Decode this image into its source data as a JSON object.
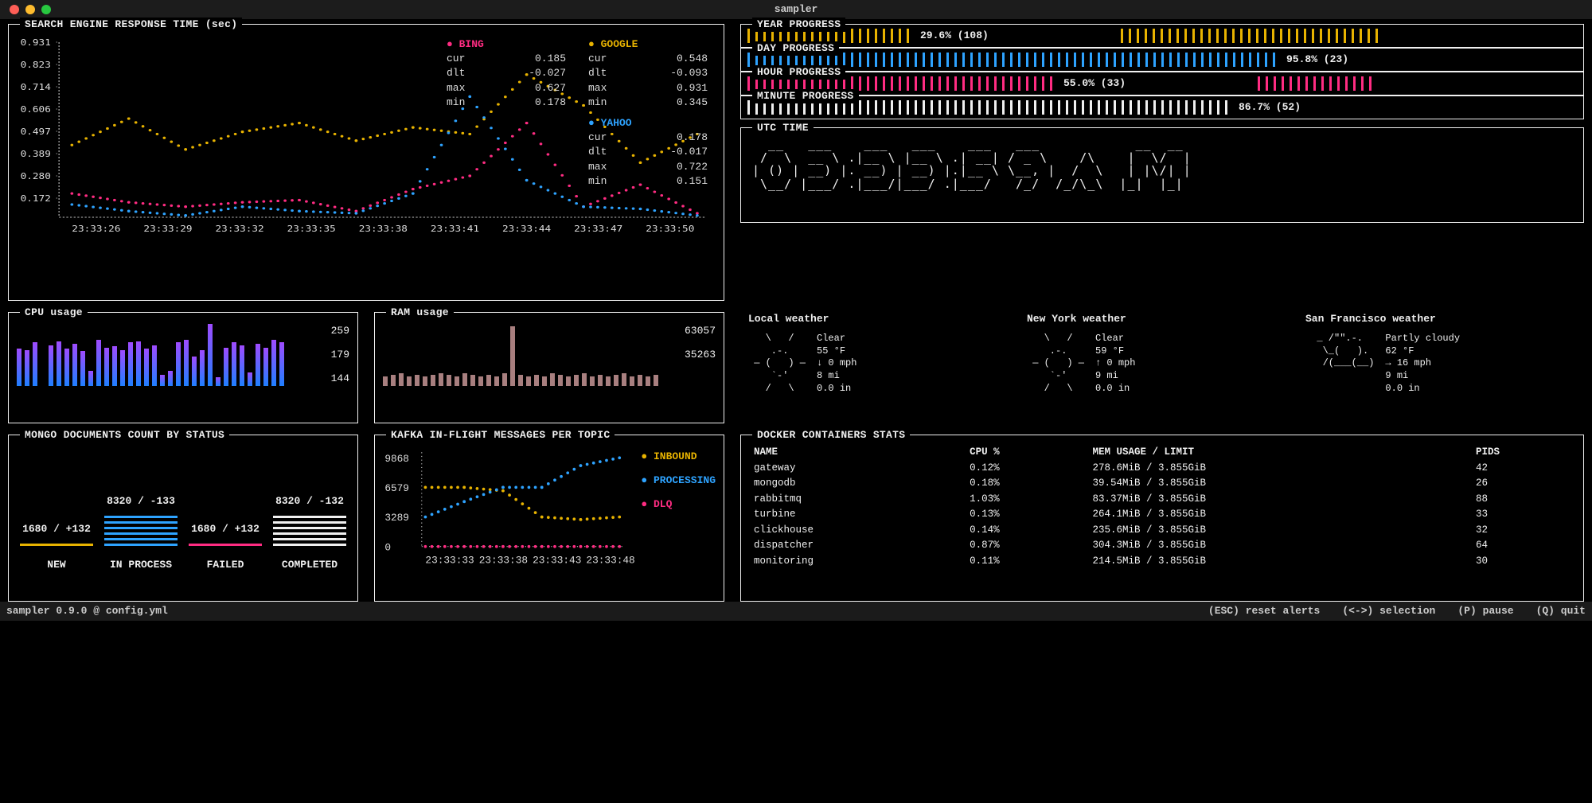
{
  "window_title": "sampler",
  "search": {
    "title": "SEARCH ENGINE RESPONSE TIME (sec)",
    "y_ticks": [
      "0.931",
      "0.823",
      "0.714",
      "0.606",
      "0.497",
      "0.389",
      "0.280",
      "0.172"
    ],
    "x_ticks": [
      "23:33:26",
      "23:33:29",
      "23:33:32",
      "23:33:35",
      "23:33:38",
      "23:33:41",
      "23:33:44",
      "23:33:47",
      "23:33:50"
    ],
    "series": [
      {
        "name": "BING",
        "color": "#ff2c82",
        "stats": {
          "cur": "0.185",
          "dlt": "-0.027",
          "max": "0.627",
          "min": "0.178"
        }
      },
      {
        "name": "GOOGLE",
        "color": "#e8b300",
        "stats": {
          "cur": "0.548",
          "dlt": "-0.093",
          "max": "0.931",
          "min": "0.345"
        }
      },
      {
        "name": "YAHOO",
        "color": "#2ea3ff",
        "stats": {
          "cur": "0.178",
          "dlt": "-0.017",
          "max": "0.722",
          "min": "0.151"
        }
      }
    ]
  },
  "progress": [
    {
      "title": "YEAR PROGRESS",
      "color": "#e8b300",
      "pct": 29.6,
      "count": 108,
      "label": "29.6% (108)"
    },
    {
      "title": "DAY PROGRESS",
      "color": "#2ea3ff",
      "pct": 95.8,
      "count": 23,
      "label": "95.8% (23)"
    },
    {
      "title": "HOUR PROGRESS",
      "color": "#ff2c82",
      "pct": 55.0,
      "count": 33,
      "label": "55.0% (33)"
    },
    {
      "title": "MINUTE PROGRESS",
      "color": "#f0f0f0",
      "pct": 86.7,
      "count": 52,
      "label": "86.7% (52)"
    }
  ],
  "utc": {
    "title": "UTC TIME",
    "ascii": "  __   ___    ___   ___    ___   ___            __  __\n /  \\  __ \\ .|__ \\ |__ \\ .| __| / _ \\    /\\    |  \\/  |\n| () | __) |. __) | __) |.|__ \\ \\__, |  /  \\   | |\\/| |\n \\__/ |___/ .|___/|___/ .|___/   /_/  /_/\\_\\  |_|  |_|",
    "display": "03:33:52 AM"
  },
  "cpu": {
    "title": "CPU usage",
    "vals": [
      "259",
      "179",
      "144"
    ],
    "bars": [
      60,
      58,
      70,
      0,
      65,
      72,
      60,
      68,
      56,
      24,
      74,
      62,
      64,
      58,
      70,
      72,
      60,
      66,
      18,
      24,
      70,
      74,
      48,
      58,
      100,
      14,
      62,
      70,
      66,
      22,
      68,
      62,
      74,
      70
    ]
  },
  "ram": {
    "title": "RAM usage",
    "vals": [
      "63057",
      "35263"
    ],
    "bars": [
      8,
      9,
      10,
      8,
      9,
      8,
      9,
      10,
      9,
      8,
      10,
      9,
      8,
      9,
      8,
      10,
      48,
      9,
      8,
      9,
      8,
      10,
      9,
      8,
      9,
      10,
      8,
      9,
      8,
      9,
      10,
      8,
      9,
      8,
      9
    ]
  },
  "mongo": {
    "title": "MONGO DOCUMENTS COUNT BY STATUS",
    "cols": [
      {
        "label": "NEW",
        "value": "1680 / +132",
        "bars": 0,
        "color": "#e8b300"
      },
      {
        "label": "IN PROCESS",
        "value": "8320 / -133",
        "bars": 5,
        "color": "#2ea3ff"
      },
      {
        "label": "FAILED",
        "value": "1680 / +132",
        "bars": 0,
        "color": "#ff2c82"
      },
      {
        "label": "COMPLETED",
        "value": "8320 / -132",
        "bars": 5,
        "color": "#f0f0f0"
      }
    ]
  },
  "kafka": {
    "title": "KAFKA IN-FLIGHT MESSAGES PER TOPIC",
    "y_ticks": [
      "9868",
      "6579",
      "3289",
      "0"
    ],
    "x_ticks": [
      "23:33:33",
      "23:33:38",
      "23:33:43",
      "23:33:48"
    ],
    "series": [
      {
        "name": "INBOUND",
        "color": "#e8b300"
      },
      {
        "name": "PROCESSING",
        "color": "#2ea3ff"
      },
      {
        "name": "DLQ",
        "color": "#ff2c82"
      }
    ]
  },
  "weather": [
    {
      "title": "Local weather",
      "icon": "   \\   /\n    .-.\n ― (   ) ―\n    `-'\n   /   \\",
      "lines": [
        "Clear",
        "55 °F",
        "↓ 0 mph",
        "8 mi",
        "0.0 in"
      ]
    },
    {
      "title": "New York weather",
      "icon": "   \\   /\n    .-.\n ― (   ) ―\n    `-'\n   /   \\",
      "lines": [
        "Clear",
        "59 °F",
        "↑ 0 mph",
        "9 mi",
        "0.0 in"
      ]
    },
    {
      "title": "San Francisco weather",
      "icon": "  _ /\"\".-.\n   \\_(   ).\n   /(___(__)\n",
      "lines": [
        "Partly cloudy",
        "62 °F",
        "→ 16 mph",
        "9 mi",
        "0.0 in"
      ]
    }
  ],
  "docker": {
    "title": "DOCKER CONTAINERS STATS",
    "headers": [
      "NAME",
      "CPU %",
      "MEM USAGE / LIMIT",
      "PIDS"
    ],
    "rows": [
      [
        "gateway",
        "0.12%",
        "278.6MiB / 3.855GiB",
        "42"
      ],
      [
        "mongodb",
        "0.18%",
        "39.54MiB / 3.855GiB",
        "26"
      ],
      [
        "rabbitmq",
        "1.03%",
        "83.37MiB / 3.855GiB",
        "88"
      ],
      [
        "turbine",
        "0.13%",
        "264.1MiB / 3.855GiB",
        "33"
      ],
      [
        "clickhouse",
        "0.14%",
        "235.6MiB / 3.855GiB",
        "32"
      ],
      [
        "dispatcher",
        "0.87%",
        "304.3MiB / 3.855GiB",
        "64"
      ],
      [
        "monitoring",
        "0.11%",
        "214.5MiB / 3.855GiB",
        "30"
      ]
    ]
  },
  "footer": {
    "left": "sampler 0.9.0 @ config.yml",
    "items": [
      "(ESC) reset alerts",
      "(<->) selection",
      "(P) pause",
      "(Q) quit"
    ]
  },
  "chart_data": {
    "search_engine_response_time": {
      "type": "line",
      "xlabel": "",
      "ylabel": "sec",
      "ylim": [
        0.172,
        0.931
      ],
      "x": [
        "23:33:26",
        "23:33:29",
        "23:33:32",
        "23:33:35",
        "23:33:38",
        "23:33:41",
        "23:33:44",
        "23:33:47",
        "23:33:50"
      ],
      "series": [
        {
          "name": "BING",
          "values": [
            0.28,
            0.24,
            0.22,
            0.24,
            0.25,
            0.2,
            0.3,
            0.36,
            0.6,
            0.22,
            0.32,
            0.19
          ]
        },
        {
          "name": "GOOGLE",
          "values": [
            0.5,
            0.62,
            0.48,
            0.56,
            0.6,
            0.52,
            0.58,
            0.55,
            0.82,
            0.68,
            0.42,
            0.55
          ]
        },
        {
          "name": "YAHOO",
          "values": [
            0.23,
            0.2,
            0.18,
            0.22,
            0.2,
            0.19,
            0.28,
            0.72,
            0.34,
            0.22,
            0.21,
            0.18
          ]
        }
      ]
    },
    "cpu_usage": {
      "type": "bar",
      "values": [
        60,
        58,
        70,
        0,
        65,
        72,
        60,
        68,
        56,
        24,
        74,
        62,
        64,
        58,
        70,
        72,
        60,
        66,
        18,
        24,
        70,
        74,
        48,
        58,
        100,
        14,
        62,
        70,
        66,
        22,
        68,
        62,
        74,
        70
      ],
      "labels": [
        "259",
        "179",
        "144"
      ]
    },
    "ram_usage": {
      "type": "bar",
      "values": [
        8,
        9,
        10,
        8,
        9,
        8,
        9,
        10,
        9,
        8,
        10,
        9,
        8,
        9,
        8,
        10,
        48,
        9,
        8,
        9,
        8,
        10,
        9,
        8,
        9,
        10,
        8,
        9,
        8,
        9,
        10,
        8,
        9,
        8,
        9
      ],
      "labels": [
        "63057",
        "35263"
      ]
    },
    "kafka": {
      "type": "line",
      "ylim": [
        0,
        9868
      ],
      "x": [
        "23:33:33",
        "23:33:38",
        "23:33:43",
        "23:33:48"
      ],
      "series": [
        {
          "name": "INBOUND",
          "values": [
            6579,
            6579,
            6200,
            3289,
            3000,
            3289
          ]
        },
        {
          "name": "PROCESSING",
          "values": [
            3289,
            5000,
            6579,
            6579,
            9000,
            9868
          ]
        },
        {
          "name": "DLQ",
          "values": [
            0,
            0,
            0,
            0,
            0,
            0
          ]
        }
      ]
    },
    "mongo": {
      "type": "bar",
      "categories": [
        "NEW",
        "IN PROCESS",
        "FAILED",
        "COMPLETED"
      ],
      "values": [
        1680,
        8320,
        1680,
        8320
      ],
      "delta": [
        "+132",
        "-133",
        "+132",
        "-132"
      ]
    },
    "progress": {
      "type": "bar",
      "categories": [
        "YEAR",
        "DAY",
        "HOUR",
        "MINUTE"
      ],
      "values": [
        29.6,
        95.8,
        55.0,
        86.7
      ]
    }
  }
}
